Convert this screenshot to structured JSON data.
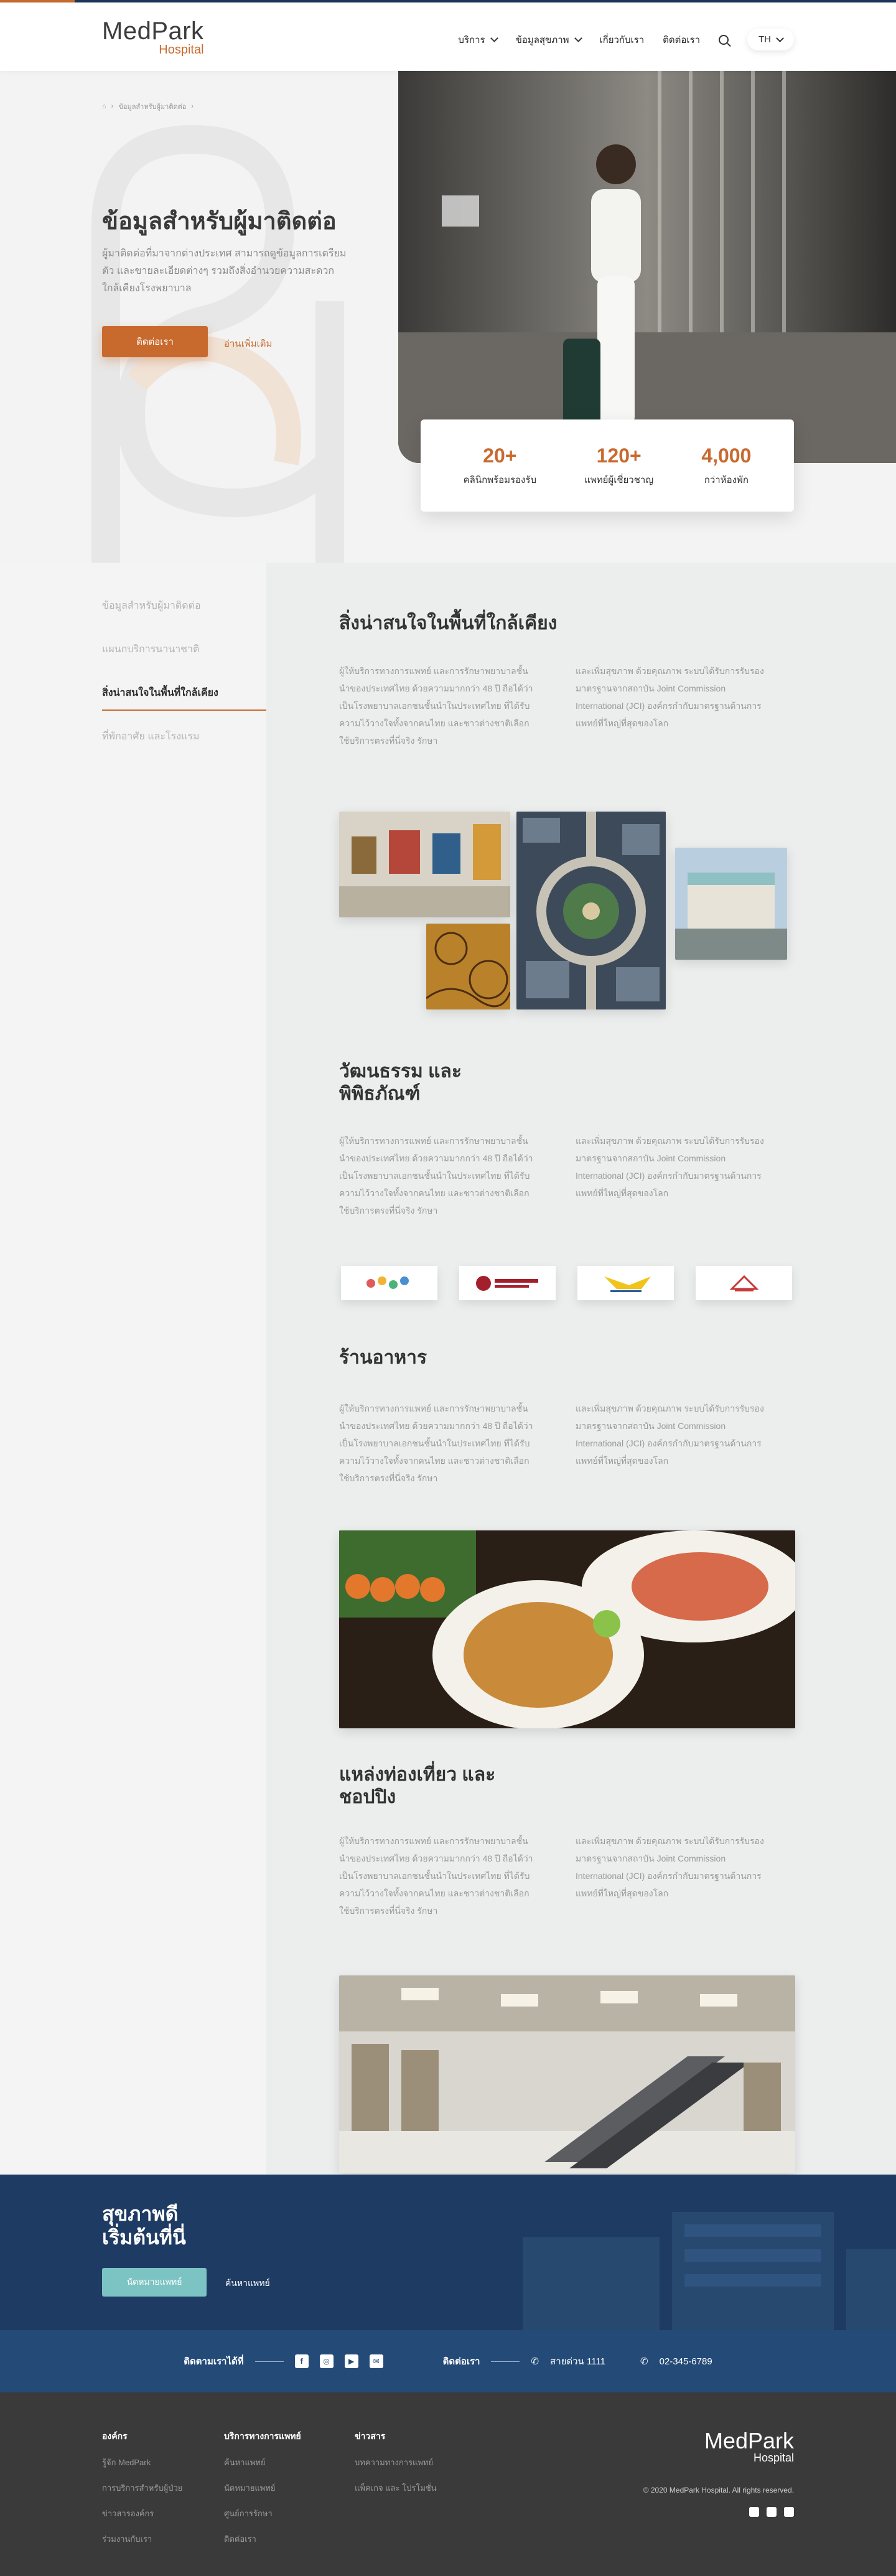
{
  "brand": {
    "name": "MedPark",
    "sub": "Hospital"
  },
  "nav": {
    "items": [
      "บริการ",
      "ข้อมูลสุขภาพ",
      "เกี่ยวกับเรา",
      "ติดต่อเรา"
    ],
    "lang": "TH"
  },
  "breadcrumb": [
    "ข้อมูลสำหรับผู้มาติดต่อ"
  ],
  "hero": {
    "title": "ข้อมูลสำหรับผู้มาติดต่อ",
    "desc": "ผู้มาติดต่อที่มาจากต่างประเทศ สามารถดูข้อมูลการเตรียมตัว และขายละเอียดต่างๆ รวมถึงสิ่งอำนวยความสะดวกใกล้เคียงโรงพยาบาล",
    "primary_button": "ติดต่อเรา",
    "link": "อ่านเพิ่มเติม"
  },
  "stats": [
    {
      "value": "20+",
      "label": "คลินิกพร้อมรองรับ"
    },
    {
      "value": "120+",
      "label": "แพทย์ผู้เชี่ยวชาญ"
    },
    {
      "value": "4,000",
      "label": "กว่าห้องพัก"
    }
  ],
  "sidebar": {
    "items": [
      "ข้อมูลสำหรับผู้มาติดต่อ",
      "แผนกบริการนานาชาติ",
      "สิ่งน่าสนใจในพื้นที่ใกล้เคียง",
      "ที่พักอาศัย และโรงแรม"
    ],
    "active": 2
  },
  "sections": [
    {
      "title": "สิ่งน่าสนใจในพื้นที่ใกล้เคียง",
      "left": "ผู้ให้บริการทางการแพทย์ และการรักษาพยาบาลชั้นนำของประเทศไทย ด้วยความมากกว่า 48 ปี ถือได้ว่าเป็นโรงพยาบาลเอกชนชั้นนำในประเทศไทย ที่ได้รับความไว้วางใจทั้งจากคนไทย และชาวต่างชาติเลือกใช้บริการตรงที่นี่จริง รักษา",
      "right": "และเพิ่มสุขภาพ ด้วยคุณภาพ ระบบได้รับการรับรองมาตรฐานจากสถาบัน Joint Commission International (JCI) องค์กรกำกับมาตรฐานด้านการแพทย์ที่ใหญ่ที่สุดของโลก"
    },
    {
      "title": "วัฒนธรรม และ\nพิพิธภัณฑ์",
      "left": "ผู้ให้บริการทางการแพทย์ และการรักษาพยาบาลชั้นนำของประเทศไทย ด้วยความมากกว่า 48 ปี ถือได้ว่าเป็นโรงพยาบาลเอกชนชั้นนำในประเทศไทย ที่ได้รับความไว้วางใจทั้งจากคนไทย และชาวต่างชาติเลือกใช้บริการตรงที่นี่จริง รักษา",
      "right": "และเพิ่มสุขภาพ ด้วยคุณภาพ ระบบได้รับการรับรองมาตรฐานจากสถาบัน Joint Commission International (JCI) องค์กรกำกับมาตรฐานด้านการแพทย์ที่ใหญ่ที่สุดของโลก"
    },
    {
      "title": "ร้านอาหาร",
      "left": "ผู้ให้บริการทางการแพทย์ และการรักษาพยาบาลชั้นนำของประเทศไทย ด้วยความมากกว่า 48 ปี ถือได้ว่าเป็นโรงพยาบาลเอกชนชั้นนำในประเทศไทย ที่ได้รับความไว้วางใจทั้งจากคนไทย และชาวต่างชาติเลือกใช้บริการตรงที่นี่จริง รักษา",
      "right": "และเพิ่มสุขภาพ ด้วยคุณภาพ ระบบได้รับการรับรองมาตรฐานจากสถาบัน Joint Commission International (JCI) องค์กรกำกับมาตรฐานด้านการแพทย์ที่ใหญ่ที่สุดของโลก"
    },
    {
      "title": "แหล่งท่องเที่ยว และ\nชอปปิง",
      "left": "ผู้ให้บริการทางการแพทย์ และการรักษาพยาบาลชั้นนำของประเทศไทย ด้วยความมากกว่า 48 ปี ถือได้ว่าเป็นโรงพยาบาลเอกชนชั้นนำในประเทศไทย ที่ได้รับความไว้วางใจทั้งจากคนไทย และชาวต่างชาติเลือกใช้บริการตรงที่นี่จริง รักษา",
      "right": "และเพิ่มสุขภาพ ด้วยคุณภาพ ระบบได้รับการรับรองมาตรฐานจากสถาบัน Joint Commission International (JCI) องค์กรกำกับมาตรฐานด้านการแพทย์ที่ใหญ่ที่สุดของโลก"
    }
  ],
  "partner_logos": [
    "bangkok-art-icon",
    "museum-logo",
    "tat-logo",
    "temple-logo"
  ],
  "cta": {
    "title": "สุขภาพดี\nเริ่มต้นที่นี่",
    "button": "นัดหมายแพทย์",
    "link": "ค้นหาแพทย์"
  },
  "contact_bar": {
    "follow": "ติดตามเราได้ที่",
    "contact": "ติดต่อเรา",
    "hotline": "สายด่วน 1111",
    "phone": "02-345-6789",
    "socials": [
      "f",
      "◎",
      "▶",
      "✉"
    ]
  },
  "footer": {
    "cols": [
      {
        "title": "องค์กร",
        "links": [
          "รู้จัก MedPark",
          "การบริการสำหรับผู้ป่วย",
          "ข่าวสารองค์กร",
          "ร่วมงานกับเรา"
        ]
      },
      {
        "title": "บริการทางการแพทย์",
        "links": [
          "ค้นหาแพทย์",
          "นัดหมายแพทย์",
          "ศูนย์การรักษา",
          "ติดต่อเรา"
        ]
      },
      {
        "title": "ข่าวสาร",
        "links": [
          "บทความทางการแพทย์",
          "แพ็คเกจ และ โปรโมชั่น"
        ]
      }
    ],
    "copyright": "© 2020 MedPark Hospital. All rights reserved."
  },
  "colors": {
    "accent": "#c86a2e",
    "navy": "#1e3b63",
    "teal": "#7cc3c3"
  }
}
